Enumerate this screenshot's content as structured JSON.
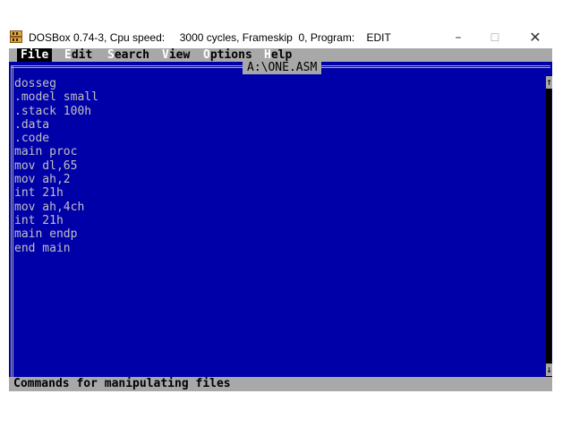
{
  "window": {
    "title": "DOSBox 0.74-3, Cpu speed:     3000 cycles, Frameskip  0, Program:    EDIT",
    "minimize_label": "–",
    "maximize_label": "☐",
    "close_label": "✕",
    "icon": "dosbox-icon"
  },
  "menu": {
    "file": "File",
    "edit_hotkey": "E",
    "edit_rest": "dit",
    "search_hotkey": "S",
    "search_rest": "earch",
    "view_hotkey": "V",
    "view_rest": "iew",
    "options_hotkey": "O",
    "options_rest": "ptions",
    "help_hotkey": "H",
    "help_rest": "elp"
  },
  "editor": {
    "filename": "A:\\ONE.ASM",
    "lines": [
      "dosseg",
      ".model small",
      ".stack 100h",
      ".data",
      ".code",
      "main proc",
      "mov dl,65",
      "mov ah,2",
      "int 21h",
      "mov ah,4ch",
      "int 21h",
      "main endp",
      "end main"
    ]
  },
  "status": {
    "text": "Commands for manipulating files"
  },
  "colors": {
    "dos_blue": "#0000a8",
    "dos_gray": "#a8a8a8",
    "text_gray": "#c0c0c0"
  }
}
